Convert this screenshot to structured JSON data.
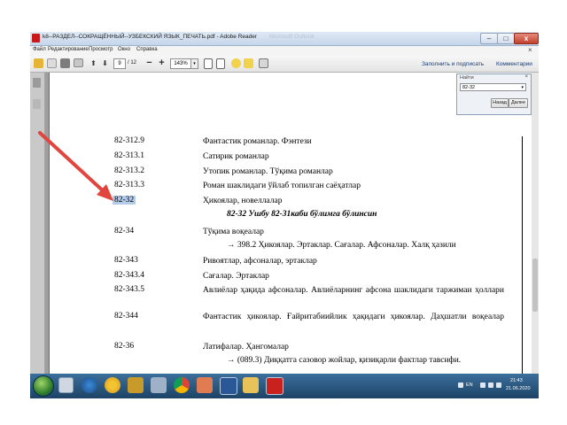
{
  "window": {
    "title": "k8--РАЗДЕЛ--СОКРАЩЁННЫЙ--УЗБЕКСКИЙ ЯЗЫК_ПЕЧАТЬ.pdf - Adobe Reader",
    "ghost_title": "Microsoft Outlook",
    "minimize_label": "–",
    "maximize_label": "□",
    "close_label": "x"
  },
  "menu": {
    "items": [
      "Файл",
      "Редактирование",
      "Просмотр",
      "Окно",
      "Справка"
    ],
    "close_label": "×"
  },
  "toolbar": {
    "up_label": "⬆",
    "down_label": "⬇",
    "page_current": "9",
    "page_total": "/ 12",
    "zoom_out_label": "−",
    "zoom_in_label": "+",
    "zoom_value": "143%",
    "zoom_arrow": "▾",
    "fill_sign_label": "Заполнить и подписать",
    "comments_label": "Комментарии"
  },
  "find": {
    "title": "Найти",
    "close_label": "×",
    "query": "82-32",
    "dropdown_arrow": "▾",
    "back_label": "Назад",
    "next_label": "Далее"
  },
  "document": {
    "rows": [
      {
        "code": "82-312.9",
        "text": "Фантастик романлар. Фэнтези"
      },
      {
        "code": "82-313.1",
        "text": "Сатирик романлар"
      },
      {
        "code": "82-313.2",
        "text": "Утопик романлар. Тўқима романлар"
      },
      {
        "code": "82-313.3",
        "text": "Роман шаклидаги ўйлаб топилган саёҳатлар"
      },
      {
        "code": "82-32",
        "text": "Ҳикоялар, новеллалар",
        "selected": true
      },
      {
        "code": "",
        "text": "82-32 Ушбу 82-31каби бўлимга бўлинсин",
        "note": true,
        "bold": true
      },
      {
        "code": "82-34",
        "text": "Тўқима воқеалар"
      },
      {
        "code": "",
        "text": "→ 398.2 Ҳикоялар. Эртаклар. Сағалар. Афсоналар. Халқ ҳазили",
        "note": true
      },
      {
        "code": "82-343",
        "text": "Ривоятлар, афсоналар, эртаклар"
      },
      {
        "code": "82-343.4",
        "text": "Сағалар. Эртаклар"
      },
      {
        "code": "82-343.5",
        "text": "Авлиёлар ҳақида афсоналар. Авлиёларнинг афсона шаклидаги таржимаи ҳоллари",
        "justify": true
      },
      {
        "code": "82-344",
        "text": "Фантастик ҳикоялар. Ғайритабиийлик ҳақидаги ҳикоялар. Даҳшатли воқеалар",
        "justify": true
      },
      {
        "code": "82-36",
        "text": "Латифалар. Ҳангомалар"
      },
      {
        "code": "",
        "text": "→ (089.3) Диққатга сазовор жойлар, қизиқарли фактлар тавсифи.",
        "note": true
      }
    ]
  },
  "taskbar": {
    "apps": [
      "file-explorer-icon",
      "app-icon",
      "chrome-icon",
      "photo-icon",
      "word-icon",
      "folder-icon",
      "acrobat-icon"
    ],
    "time": "21:43",
    "date": "21.06.2020",
    "lang": "EN"
  },
  "colors": {
    "selection": "#b3cbe9",
    "arrow": "#e0453e",
    "taskbar": "#1d4366"
  }
}
